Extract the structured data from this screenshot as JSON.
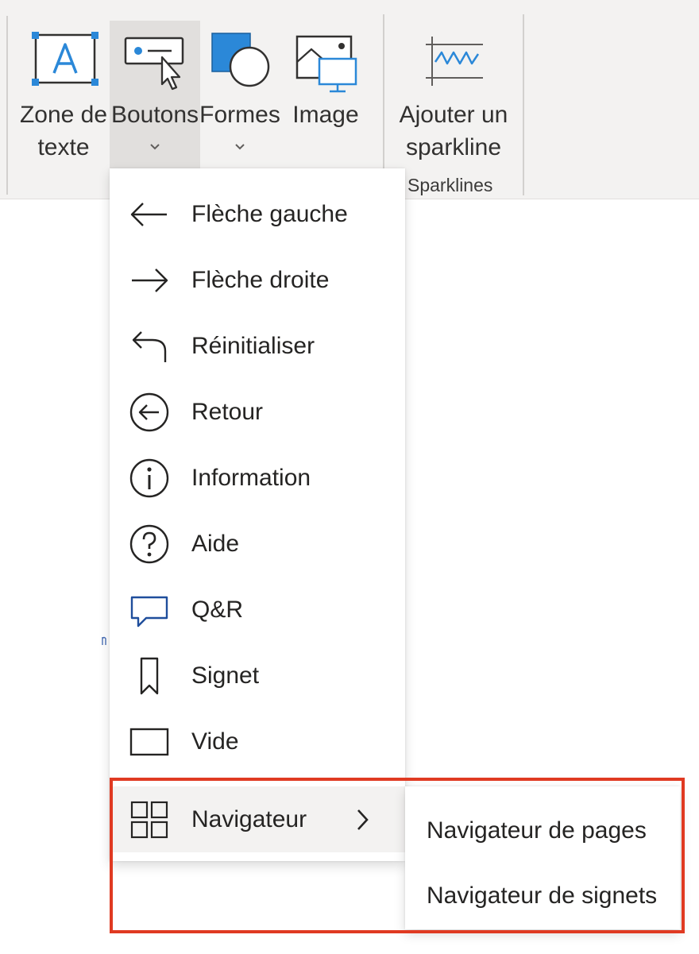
{
  "ribbon": {
    "buttons": [
      {
        "label": "Zone de\ntexte",
        "icon": "text-box-icon"
      },
      {
        "label": "Boutons",
        "icon": "buttons-icon",
        "has_dropdown": true,
        "active": true
      },
      {
        "label": "Formes",
        "icon": "shapes-icon",
        "has_dropdown": true
      },
      {
        "label": "Image",
        "icon": "image-icon"
      },
      {
        "label": "Ajouter un\nsparkline",
        "icon": "sparkline-icon"
      }
    ],
    "group_label": "Sparklines"
  },
  "menu": {
    "items": [
      {
        "label": "Flèche gauche",
        "icon": "arrow-left-icon"
      },
      {
        "label": "Flèche droite",
        "icon": "arrow-right-icon"
      },
      {
        "label": "Réinitialiser",
        "icon": "reset-icon"
      },
      {
        "label": "Retour",
        "icon": "back-circle-icon"
      },
      {
        "label": "Information",
        "icon": "information-icon"
      },
      {
        "label": "Aide",
        "icon": "help-icon"
      },
      {
        "label": "Q&R",
        "icon": "qna-icon"
      },
      {
        "label": "Signet",
        "icon": "bookmark-icon"
      },
      {
        "label": "Vide",
        "icon": "blank-icon"
      },
      {
        "label": "Navigateur",
        "icon": "navigator-grid-icon",
        "has_submenu": true,
        "hovered": true
      }
    ]
  },
  "submenu": {
    "items": [
      {
        "label": "Navigateur de pages"
      },
      {
        "label": "Navigateur de signets"
      }
    ]
  },
  "colors": {
    "ribbon_bg": "#f3f2f1",
    "accent_blue": "#2b88d8",
    "highlight_red": "#e03a22"
  }
}
